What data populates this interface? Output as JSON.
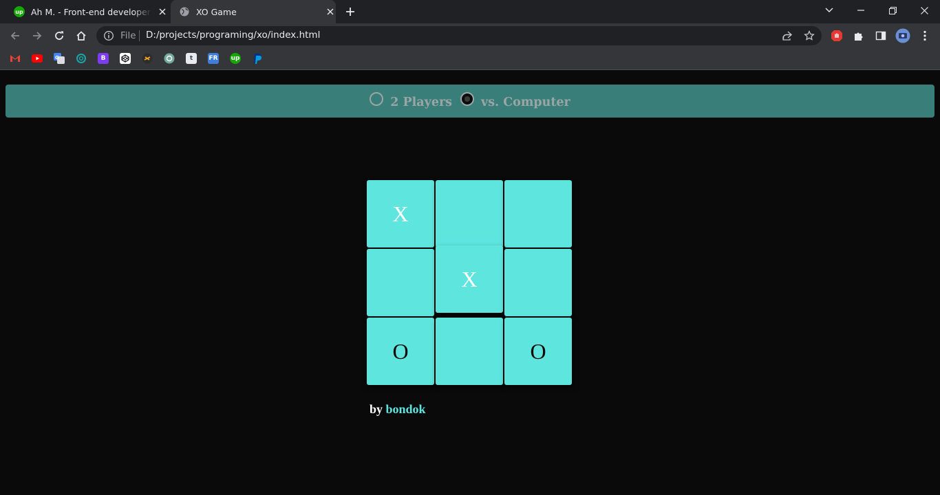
{
  "browser": {
    "tabs": [
      {
        "title": "Ah M. - Front-end developer | log",
        "favicon": "upwork-icon",
        "favicon_text": "up",
        "active": false
      },
      {
        "title": "XO Game",
        "favicon": "globe-icon",
        "active": true
      }
    ],
    "address": {
      "scheme_label": "File",
      "url": "D:/projects/programing/xo/index.html"
    },
    "bookmarks": [
      "gmail-icon",
      "youtube-icon",
      "translate-icon",
      "openai-swirl-icon",
      "bootstrap-icon",
      "codepen-icon",
      "sololearn-icon",
      "chatgpt-icon",
      "tumblr-icon",
      "frontend-mentor-icon",
      "upwork-icon",
      "paypal-icon"
    ]
  },
  "game": {
    "modes": [
      {
        "label": "2 Players",
        "checked": false
      },
      {
        "label": "vs. Computer",
        "checked": true
      }
    ],
    "board": [
      "X",
      "",
      "",
      "",
      "X",
      "",
      "O",
      "",
      "O"
    ],
    "credit_prefix": "by",
    "credit_author": "bondok"
  },
  "colors": {
    "mode_bar": "#3a7e7a",
    "cell": "#5ee5de",
    "page_bg": "#0a0a0a",
    "author": "#5ee5de"
  }
}
